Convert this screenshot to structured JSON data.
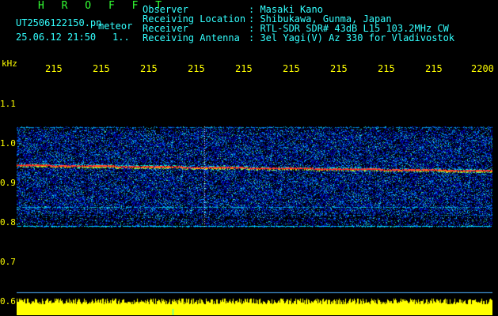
{
  "header": {
    "program": "H R O F F T",
    "filename": "UT2506122150.pn",
    "tag": "meteor",
    "date_time": "25.06.12 21:50",
    "counter": "1.."
  },
  "info": {
    "labels": [
      "Observer",
      "Receiving Location",
      "Receiver",
      "Receiving Antenna"
    ],
    "values": [
      ": Masaki Kano",
      ": Shibukawa, Gunma, Japan",
      ": RTL-SDR SDR# 43dB L15 103.2MHz CW",
      ": 3el Yagi(V) Az 330 for Vladivostok"
    ]
  },
  "axes": {
    "unit_label": "kHz",
    "x_ticks": [
      "215",
      "215",
      "215",
      "215",
      "215",
      "215",
      "215",
      "215",
      "215",
      "2200"
    ],
    "y_ticks": [
      "1.1",
      "1.0",
      "0.9",
      "0.8",
      "0.7",
      "0.6"
    ]
  },
  "colors": {
    "background": "#000000",
    "text": "#33ffff",
    "title": "#33ff33",
    "axis_labels": "#ffff00",
    "noise_low": "#0000aa",
    "noise_high": "#00ffff",
    "signal": "#ff3333",
    "floor_bar": "#ffff00"
  }
}
